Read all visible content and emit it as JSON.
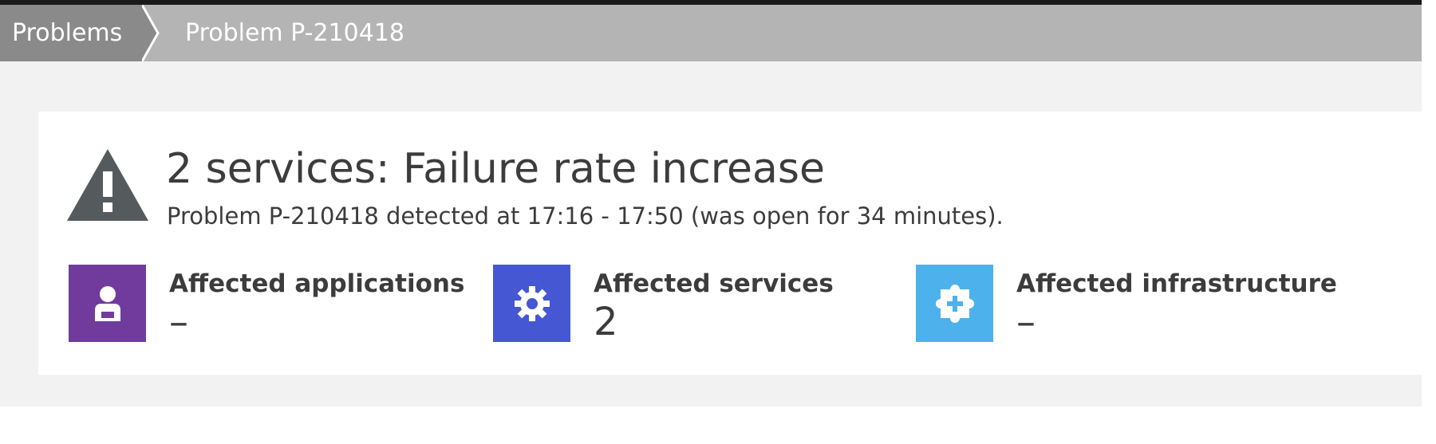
{
  "breadcrumb": {
    "root_label": "Problems",
    "current_label": "Problem P-210418"
  },
  "problem": {
    "title": "2 services: Failure rate increase",
    "subtitle": "Problem P-210418 detected at 17:16 - 17:50 (was open for 34 minutes).",
    "severity_icon": "warning-triangle-icon"
  },
  "tiles": [
    {
      "label": "Affected applications",
      "value": "–",
      "icon": "user-icon",
      "color": "#713b9d"
    },
    {
      "label": "Affected services",
      "value": "2",
      "icon": "gear-icon",
      "color": "#4557d2"
    },
    {
      "label": "Affected infrastructure",
      "value": "–",
      "icon": "puzzle-plus-icon",
      "color": "#4db1eb"
    }
  ],
  "colors": {
    "breadcrumb_bg": "#b4b4b4",
    "breadcrumb_active_bg": "#8a8a8a",
    "warning_icon": "#555a5d",
    "text": "#3c3c3c"
  }
}
